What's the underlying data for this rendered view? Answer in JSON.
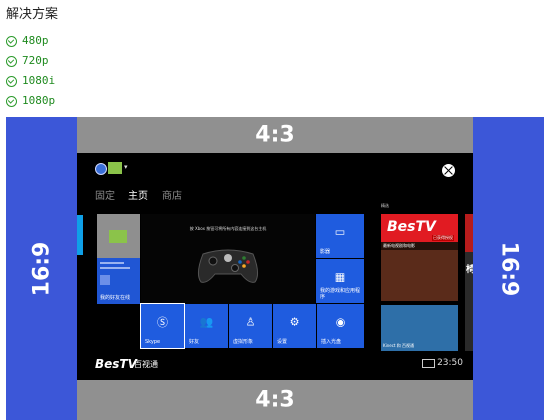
{
  "page": {
    "title": "解决方案",
    "resolutions": [
      {
        "label": "480p",
        "icon": "download-icon"
      },
      {
        "label": "720p",
        "icon": "download-icon"
      },
      {
        "label": "1080i",
        "icon": "download-icon"
      },
      {
        "label": "1080p",
        "icon": "download-icon"
      }
    ]
  },
  "diagram": {
    "left_ratio": "16:9",
    "right_ratio": "16:9",
    "top_ratio": "4:3",
    "bottom_ratio": "4:3",
    "colors": {
      "side_band": "#3c57d8",
      "letterbox": "#909090",
      "screen": "#000000"
    }
  },
  "xbox": {
    "nav": [
      "固定",
      "主页",
      "商店"
    ],
    "active_nav": "主页",
    "feature_caption": "按 Xbox 按钮可将所有内容连接到这台主机",
    "tiles": [
      {
        "label": "Skype",
        "icon": "skype-icon"
      },
      {
        "label": "好友",
        "icon": "friends-icon"
      },
      {
        "label": "虚拟形象",
        "icon": "avatar-icon"
      },
      {
        "label": "设置",
        "icon": "gear-icon"
      },
      {
        "label": "插入光盘",
        "icon": "disc-icon"
      }
    ],
    "tile_tv_label": "影器",
    "tile_apps_label": "我的游戏和应用程序",
    "user_tile_label": "我的好友在线",
    "right_panel_label": "精选",
    "bestv_logo": "BesTV",
    "bestv_sub": "已获得授权",
    "photo1_caption": "最新电视剧和电影",
    "photo2_caption": "Kinect 和 百视通",
    "right_strip_char": "椅",
    "brand_logo": "BesTV",
    "brand_cn": "百视通",
    "clock": "23:50"
  }
}
